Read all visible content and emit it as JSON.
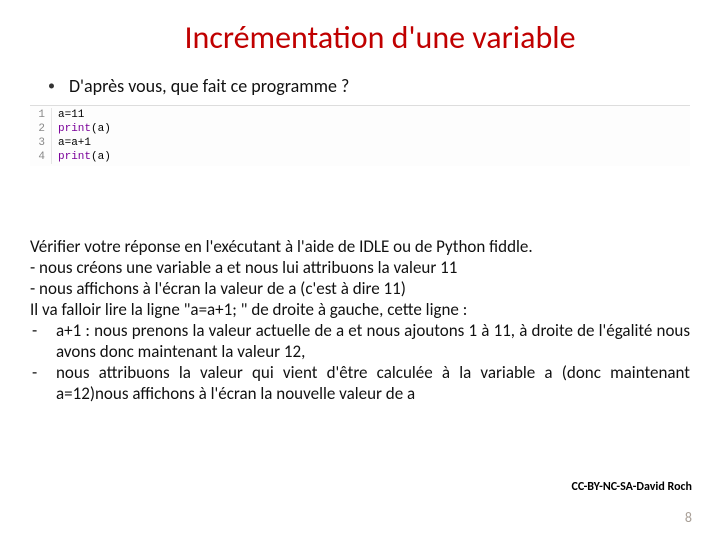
{
  "title": "Incrémentation d'une variable",
  "bullet": {
    "dot": "•",
    "text": "D'après vous, que fait ce programme ?"
  },
  "code": {
    "lines": [
      {
        "n": "1",
        "plain": "a=11"
      },
      {
        "n": "2",
        "fn": "print",
        "rest": "(a)"
      },
      {
        "n": "3",
        "plain": "a=a+1"
      },
      {
        "n": "4",
        "fn": "print",
        "rest": "(a)"
      }
    ]
  },
  "body": {
    "p1": "Vérifier votre réponse en l'exécutant à l'aide de IDLE ou de Python fiddle.",
    "p2": "- nous créons une variable a et nous lui attribuons la valeur 11",
    "p3": "- nous affichons à l'écran la valeur de a (c'est à dire 11)",
    "p4": "Il va falloir lire la ligne \"a=a+1; \" de droite à gauche, cette ligne :",
    "i1_dash": "-",
    "i1": "a+1 : nous prenons la valeur actuelle de a et nous ajoutons 1 à 11, à droite de l'égalité nous avons donc maintenant la valeur 12,",
    "i2_dash": "-",
    "i2": "nous attribuons la valeur qui vient d'être calculée à la variable a (donc maintenant a=12)nous affichons à l'écran la nouvelle valeur de a"
  },
  "credit": "CC-BY-NC-SA-David Roch",
  "page": "8"
}
